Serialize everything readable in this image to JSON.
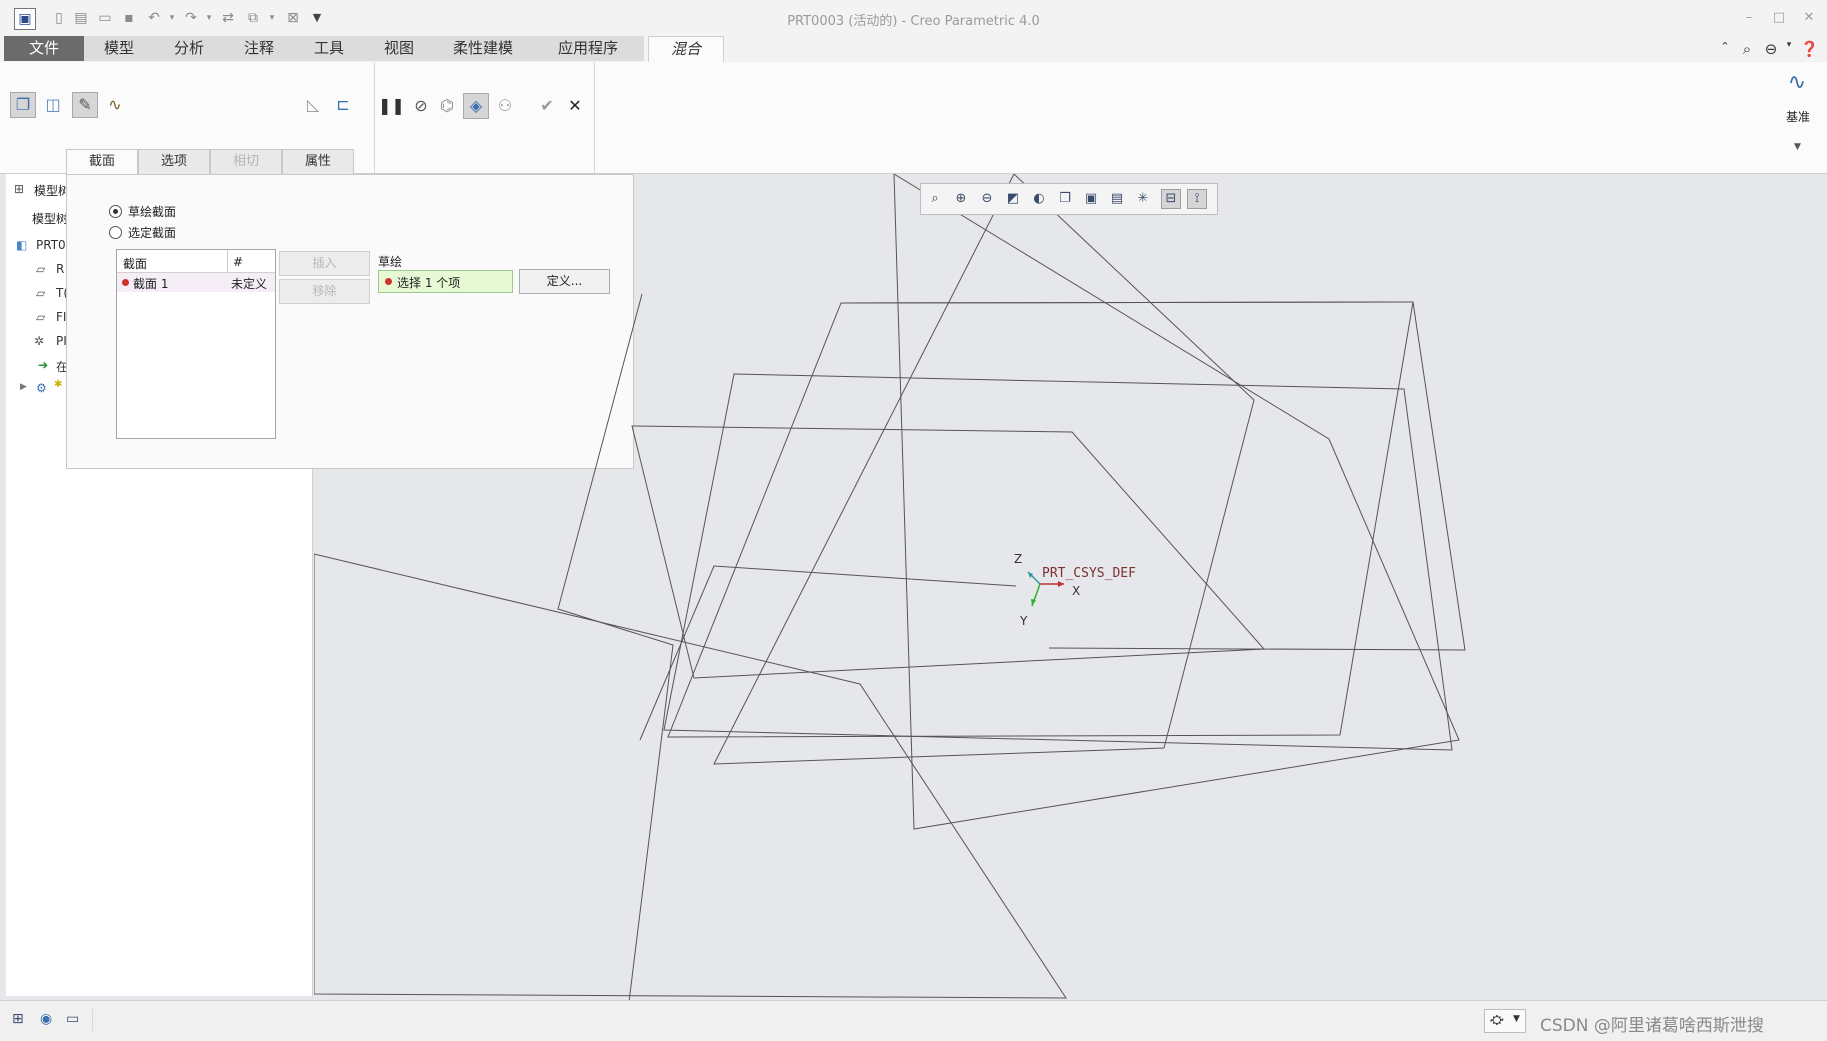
{
  "window": {
    "title": "PRT0003 (活动的) - Creo Parametric 4.0",
    "controls": [
      "minimize-icon",
      "maximize-icon",
      "close-icon"
    ]
  },
  "quick_access": {
    "icons": [
      "new-icon",
      "open-icon",
      "open-folder-icon",
      "save-icon",
      "undo-icon",
      "redo-icon",
      "regenerate-icon",
      "windows-icon",
      "close-window-icon",
      "customize-icon"
    ]
  },
  "menu": {
    "tabs": [
      {
        "label": "文件"
      },
      {
        "label": "模型"
      },
      {
        "label": "分析"
      },
      {
        "label": "注释"
      },
      {
        "label": "工具"
      },
      {
        "label": "视图"
      },
      {
        "label": "柔性建模"
      },
      {
        "label": "应用程序"
      },
      {
        "label": "混合"
      }
    ],
    "active_index": 8
  },
  "ribbon": {
    "datum_label": "基准",
    "subtabs": [
      {
        "label": "截面"
      },
      {
        "label": "选项"
      },
      {
        "label": "相切"
      },
      {
        "label": "属性"
      }
    ]
  },
  "panel": {
    "radio_sketch": "草绘截面",
    "radio_select": "选定截面",
    "table": {
      "headers": [
        "截面",
        "#"
      ],
      "rows": [
        {
          "name": "截面 1",
          "status": "未定义"
        }
      ]
    },
    "insert_label": "插入",
    "remove_label": "移除",
    "sketch_label": "草绘",
    "select_collector": "选择 1 个项",
    "define_label": "定义..."
  },
  "tree": {
    "title": "模型树",
    "header": "模型树",
    "items": [
      "PRT0",
      "R",
      "T(",
      "FI",
      "PI",
      "在"
    ]
  },
  "viewport": {
    "csys_label": "PRT_CSYS_DEF",
    "axis_z": "Z",
    "axis_x": "X",
    "axis_y": "Y"
  },
  "status": {
    "watermark": "CSDN @阿里诸葛啥西斯泄搜"
  },
  "colors": {
    "viewport_bg": "#e6e7eb",
    "file_tab": "#6b6b6b",
    "status_red": "#d0312d",
    "collector_bg": "#e6f9d4"
  }
}
